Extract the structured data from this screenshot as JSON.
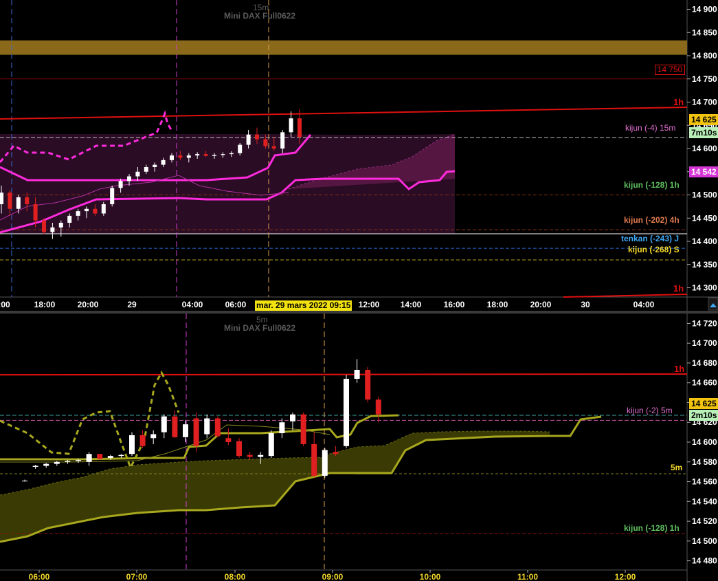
{
  "colors": {
    "background": "#000000",
    "grid": "#2a2a2a",
    "axis_text": "#ffffff",
    "top_cloud": "#5a1846",
    "top_line": "#ff2bdc",
    "bottom_cloud": "#3a3a05",
    "bottom_line": "#a8a81e",
    "resistance_band": "#8a6a1a",
    "red_line": "#e01010",
    "up_candle": "#ffffff",
    "down_candle": "#e02020"
  },
  "top_panel": {
    "timeframe": "15m",
    "instrument": "Mini DAX Full0622",
    "price_ticks": [
      "14 900",
      "14 850",
      "14 800",
      "14 750",
      "14 700",
      "14 650",
      "14 600",
      "14 550",
      "14 500",
      "14 450",
      "14 400",
      "14 350",
      "14 300"
    ],
    "time_ticks": [
      ":00",
      "18:00",
      "20:00",
      "29",
      "04:00",
      "06:00",
      "12:00",
      "14:00",
      "16:00",
      "18:00",
      "20:00",
      "30",
      "04:00"
    ],
    "crosshair_label": "mar. 29 mars 2022 09:15",
    "labels": {
      "level_14750": "14 750",
      "red_line_1h_top": "1h",
      "kijun_15m": "kijun (-4) 15m",
      "price_now": "14 625",
      "countdown": "7m10s",
      "cloud_top": "14 542",
      "kijun_1h": "kijun (-128) 1h",
      "kijun_4h": "kijun (-202) 4h",
      "tenkan_j": "tenkan (-243) J",
      "kijun_s": "kijun (-268) S",
      "red_line_1h_bottom": "1h"
    }
  },
  "bottom_panel": {
    "timeframe": "5m",
    "instrument": "Mini DAX Full0622",
    "price_ticks": [
      "14 720",
      "14 700",
      "14 680",
      "14 660",
      "14 640",
      "14 620",
      "14 600",
      "14 580",
      "14 560",
      "14 540",
      "14 520",
      "14 500",
      "14 480"
    ],
    "time_ticks": [
      "06:00",
      "07:00",
      "08:00",
      "09:00",
      "10:00",
      "11:00",
      "12:00"
    ],
    "labels": {
      "red_line_1h": "1h",
      "kijun_5m": "kijun (-2) 5m",
      "price_now": "14 625",
      "countdown": "2m10s",
      "level_5m": "5m",
      "kijun_1h": "kijun (-128) 1h"
    }
  },
  "chart_data": [
    {
      "type": "candlestick",
      "title": "Mini DAX Full0622",
      "subtitle": "15m",
      "ylim": [
        14280,
        14920
      ],
      "x_ticks": [
        ":00",
        "18:00",
        "20:00",
        "29",
        "04:00",
        "06:00",
        "12:00",
        "14:00",
        "16:00",
        "18:00",
        "20:00",
        "30",
        "04:00"
      ],
      "candles": [
        {
          "o": 14480,
          "h": 14520,
          "l": 14460,
          "c": 14505
        },
        {
          "o": 14505,
          "h": 14510,
          "l": 14455,
          "c": 14470
        },
        {
          "o": 14470,
          "h": 14500,
          "l": 14460,
          "c": 14495
        },
        {
          "o": 14495,
          "h": 14505,
          "l": 14465,
          "c": 14480
        },
        {
          "o": 14480,
          "h": 14495,
          "l": 14430,
          "c": 14445
        },
        {
          "o": 14445,
          "h": 14450,
          "l": 14415,
          "c": 14420
        },
        {
          "o": 14420,
          "h": 14440,
          "l": 14405,
          "c": 14430
        },
        {
          "o": 14430,
          "h": 14445,
          "l": 14410,
          "c": 14440
        },
        {
          "o": 14440,
          "h": 14460,
          "l": 14430,
          "c": 14455
        },
        {
          "o": 14455,
          "h": 14470,
          "l": 14445,
          "c": 14465
        },
        {
          "o": 14465,
          "h": 14475,
          "l": 14450,
          "c": 14470
        },
        {
          "o": 14470,
          "h": 14480,
          "l": 14455,
          "c": 14460
        },
        {
          "o": 14460,
          "h": 14485,
          "l": 14455,
          "c": 14480
        },
        {
          "o": 14480,
          "h": 14520,
          "l": 14475,
          "c": 14515
        },
        {
          "o": 14515,
          "h": 14535,
          "l": 14505,
          "c": 14530
        },
        {
          "o": 14530,
          "h": 14545,
          "l": 14520,
          "c": 14540
        },
        {
          "o": 14540,
          "h": 14560,
          "l": 14530,
          "c": 14550
        },
        {
          "o": 14550,
          "h": 14565,
          "l": 14545,
          "c": 14560
        },
        {
          "o": 14560,
          "h": 14570,
          "l": 14550,
          "c": 14565
        },
        {
          "o": 14565,
          "h": 14580,
          "l": 14560,
          "c": 14575
        },
        {
          "o": 14575,
          "h": 14590,
          "l": 14570,
          "c": 14585
        },
        {
          "o": 14585,
          "h": 14595,
          "l": 14575,
          "c": 14580
        },
        {
          "o": 14580,
          "h": 14590,
          "l": 14570,
          "c": 14585
        },
        {
          "o": 14585,
          "h": 14592,
          "l": 14578,
          "c": 14588
        },
        {
          "o": 14588,
          "h": 14595,
          "l": 14582,
          "c": 14584
        },
        {
          "o": 14584,
          "h": 14590,
          "l": 14578,
          "c": 14586
        },
        {
          "o": 14586,
          "h": 14592,
          "l": 14580,
          "c": 14588
        },
        {
          "o": 14588,
          "h": 14594,
          "l": 14582,
          "c": 14590
        },
        {
          "o": 14590,
          "h": 14612,
          "l": 14585,
          "c": 14608
        },
        {
          "o": 14608,
          "h": 14640,
          "l": 14600,
          "c": 14630
        },
        {
          "o": 14630,
          "h": 14645,
          "l": 14610,
          "c": 14620
        },
        {
          "o": 14620,
          "h": 14630,
          "l": 14600,
          "c": 14605
        },
        {
          "o": 14605,
          "h": 14625,
          "l": 14595,
          "c": 14600
        },
        {
          "o": 14600,
          "h": 14640,
          "l": 14590,
          "c": 14635
        },
        {
          "o": 14635,
          "h": 14680,
          "l": 14625,
          "c": 14665
        },
        {
          "o": 14665,
          "h": 14685,
          "l": 14610,
          "c": 14625
        }
      ],
      "series": [
        {
          "name": "kijun (-4) 15m",
          "value": 14625
        },
        {
          "name": "kijun (-128) 1h",
          "value": 14500
        },
        {
          "name": "kijun (-202) 4h",
          "value": 14425
        },
        {
          "name": "tenkan (-243) J",
          "value": 14385
        },
        {
          "name": "kijun (-268) S",
          "value": 14360
        }
      ],
      "levels": {
        "resistance_band": [
          14802,
          14833
        ],
        "red_level": 14750,
        "last_price": 14625,
        "cloud_top": 14542
      }
    },
    {
      "type": "candlestick",
      "title": "Mini DAX Full0622",
      "subtitle": "5m",
      "ylim": [
        14470,
        14730
      ],
      "x_ticks": [
        "06:00",
        "07:00",
        "08:00",
        "09:00",
        "10:00",
        "11:00",
        "12:00"
      ],
      "candles": [
        {
          "o": 14561,
          "h": 14562,
          "l": 14560,
          "c": 14561
        },
        {
          "o": 14575,
          "h": 14577,
          "l": 14573,
          "c": 14576
        },
        {
          "o": 14576,
          "h": 14579,
          "l": 14574,
          "c": 14578
        },
        {
          "o": 14578,
          "h": 14581,
          "l": 14576,
          "c": 14580
        },
        {
          "o": 14580,
          "h": 14582,
          "l": 14578,
          "c": 14581
        },
        {
          "o": 14581,
          "h": 14583,
          "l": 14579,
          "c": 14582
        },
        {
          "o": 14580,
          "h": 14590,
          "l": 14576,
          "c": 14588
        },
        {
          "o": 14588,
          "h": 14586,
          "l": 14582,
          "c": 14583
        },
        {
          "o": 14584,
          "h": 14587,
          "l": 14582,
          "c": 14586
        },
        {
          "o": 14586,
          "h": 14588,
          "l": 14584,
          "c": 14587
        },
        {
          "o": 14588,
          "h": 14610,
          "l": 14586,
          "c": 14607
        },
        {
          "o": 14607,
          "h": 14612,
          "l": 14594,
          "c": 14596
        },
        {
          "o": 14604,
          "h": 14612,
          "l": 14598,
          "c": 14608
        },
        {
          "o": 14610,
          "h": 14628,
          "l": 14604,
          "c": 14626
        },
        {
          "o": 14626,
          "h": 14632,
          "l": 14604,
          "c": 14605
        },
        {
          "o": 14605,
          "h": 14622,
          "l": 14600,
          "c": 14618
        },
        {
          "o": 14624,
          "h": 14630,
          "l": 14590,
          "c": 14596
        },
        {
          "o": 14608,
          "h": 14628,
          "l": 14604,
          "c": 14624
        },
        {
          "o": 14624,
          "h": 14626,
          "l": 14605,
          "c": 14606
        },
        {
          "o": 14604,
          "h": 14614,
          "l": 14597,
          "c": 14600
        },
        {
          "o": 14601,
          "h": 14604,
          "l": 14584,
          "c": 14586
        },
        {
          "o": 14587,
          "h": 14590,
          "l": 14582,
          "c": 14585
        },
        {
          "o": 14585,
          "h": 14590,
          "l": 14578,
          "c": 14587
        },
        {
          "o": 14586,
          "h": 14612,
          "l": 14584,
          "c": 14609
        },
        {
          "o": 14609,
          "h": 14624,
          "l": 14604,
          "c": 14620
        },
        {
          "o": 14621,
          "h": 14630,
          "l": 14612,
          "c": 14628
        },
        {
          "o": 14628,
          "h": 14630,
          "l": 14596,
          "c": 14598
        },
        {
          "o": 14598,
          "h": 14610,
          "l": 14564,
          "c": 14566
        },
        {
          "o": 14566,
          "h": 14594,
          "l": 14564,
          "c": 14592
        },
        {
          "o": 14590,
          "h": 14596,
          "l": 14586,
          "c": 14588
        },
        {
          "o": 14596,
          "h": 14668,
          "l": 14594,
          "c": 14664
        },
        {
          "o": 14664,
          "h": 14684,
          "l": 14660,
          "c": 14673
        },
        {
          "o": 14673,
          "h": 14676,
          "l": 14640,
          "c": 14643
        },
        {
          "o": 14643,
          "h": 14646,
          "l": 14620,
          "c": 14628
        }
      ],
      "series": [
        {
          "name": "kijun (-2) 5m",
          "value": 14625
        },
        {
          "name": "kijun (-128) 1h",
          "value": 14500
        }
      ],
      "levels": {
        "red_line_1h": 14668,
        "last_price": 14625,
        "level_5m": 14562
      }
    }
  ]
}
